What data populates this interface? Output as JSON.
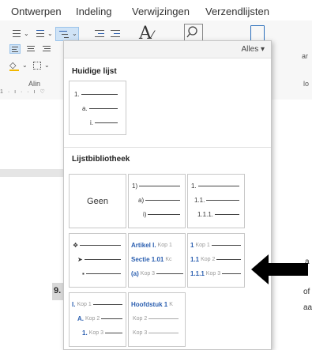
{
  "ribbon": {
    "tabs": [
      "Ontwerpen",
      "Indeling",
      "Verwijzingen",
      "Verzendlijsten"
    ],
    "group_label_left": "Alin",
    "group_label_right": "lo",
    "side_right_1": "ar",
    "side_right_2": "a"
  },
  "document": {
    "heading_number": "9.",
    "right_fragment_1": "a",
    "right_fragment_2": "of",
    "right_fragment_3": "aa"
  },
  "dropdown": {
    "filter_label": "Alles ▾",
    "current_section": "Huidige lijst",
    "library_section": "Lijstbibliotheek",
    "current_list": [
      {
        "marker": "1."
      },
      {
        "marker": "a."
      },
      {
        "marker": "i."
      }
    ],
    "library": [
      {
        "name": "Geen",
        "type": "none"
      },
      {
        "type": "rows",
        "rows": [
          {
            "marker": "1)",
            "label": ""
          },
          {
            "marker": "a)",
            "label": ""
          },
          {
            "marker": "i)",
            "label": ""
          }
        ]
      },
      {
        "type": "rows",
        "rows": [
          {
            "marker": "1.",
            "label": ""
          },
          {
            "marker": "1.1.",
            "label": ""
          },
          {
            "marker": "1.1.1.",
            "label": ""
          }
        ]
      },
      {
        "type": "rows",
        "rows": [
          {
            "marker": "❖",
            "label": ""
          },
          {
            "marker": "➤",
            "label": ""
          },
          {
            "marker": "▪",
            "label": ""
          }
        ]
      },
      {
        "type": "rows",
        "rows": [
          {
            "marker": "Artikel I.",
            "label": "Kop 1"
          },
          {
            "marker": "Sectie 1.01",
            "label": "Kc"
          },
          {
            "marker": "(a)",
            "label": "Kop 3"
          }
        ]
      },
      {
        "type": "rows",
        "rows": [
          {
            "marker": "1",
            "label": "Kop 1"
          },
          {
            "marker": "1.1",
            "label": "Kop 2"
          },
          {
            "marker": "1.1.1",
            "label": "Kop 3"
          }
        ]
      },
      {
        "type": "rows",
        "rows": [
          {
            "marker": "I.",
            "label": "Kop 1"
          },
          {
            "marker": "A.",
            "label": "Kop 2"
          },
          {
            "marker": "1.",
            "label": "Kop 3"
          }
        ]
      },
      {
        "type": "rows",
        "rows": [
          {
            "marker": "Hoofdstuk 1",
            "label": "K"
          },
          {
            "marker": "",
            "label": "Kop 2"
          },
          {
            "marker": "",
            "label": "Kop 3"
          }
        ]
      }
    ]
  },
  "colors": {
    "tile_border": "#c8c8c8",
    "arrow": "#000000",
    "ribbon_bg": "#f7f7f7"
  }
}
